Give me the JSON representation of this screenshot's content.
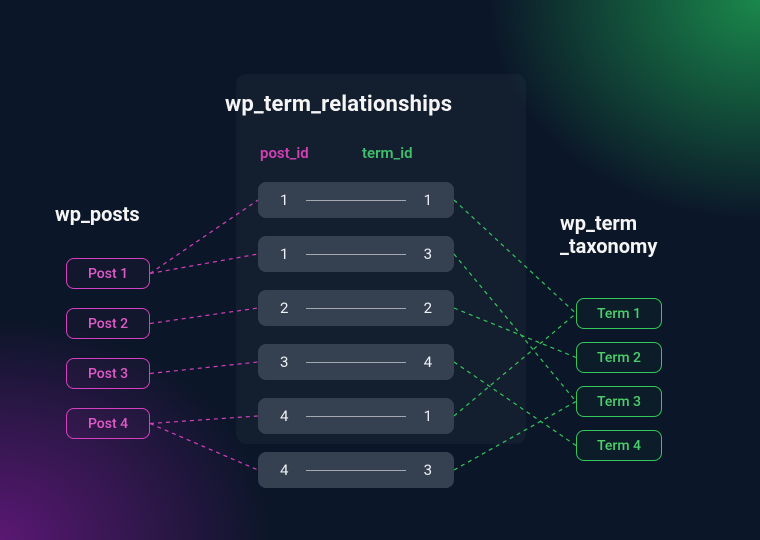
{
  "titles": {
    "posts": "wp_posts",
    "relationships": "wp_term_relationships",
    "terms": "wp_term\n_taxonomy"
  },
  "columns": {
    "post": "post_id",
    "term": "term_id"
  },
  "posts": [
    {
      "label": "Post 1"
    },
    {
      "label": "Post 2"
    },
    {
      "label": "Post 3"
    },
    {
      "label": "Post 4"
    }
  ],
  "terms": [
    {
      "label": "Term 1"
    },
    {
      "label": "Term 2"
    },
    {
      "label": "Term 3"
    },
    {
      "label": "Term 4"
    }
  ],
  "relationships": [
    {
      "post_id": "1",
      "term_id": "1"
    },
    {
      "post_id": "1",
      "term_id": "3"
    },
    {
      "post_id": "2",
      "term_id": "2"
    },
    {
      "post_id": "3",
      "term_id": "4"
    },
    {
      "post_id": "4",
      "term_id": "1"
    },
    {
      "post_id": "4",
      "term_id": "3"
    }
  ],
  "colors": {
    "post": "#d63fbf",
    "term": "#34c759"
  }
}
